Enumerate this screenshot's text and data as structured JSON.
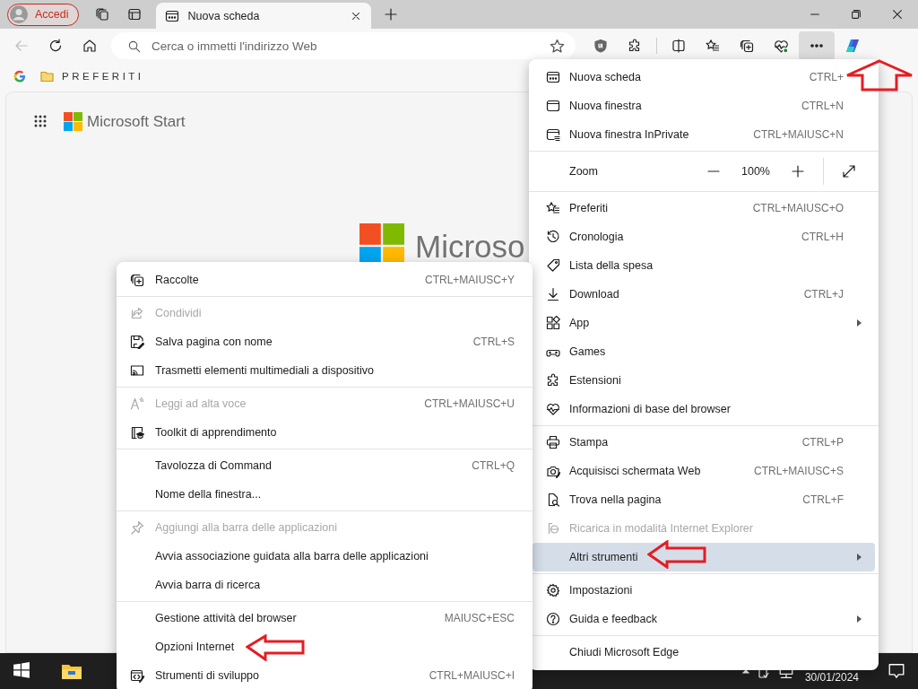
{
  "tab_strip": {
    "profile_button": "Accedi",
    "tabs": [
      {
        "label": "Nuova scheda",
        "selected": true
      }
    ]
  },
  "toolbar": {
    "address_placeholder": "Cerca o immetti l'indirizzo Web",
    "menu_button_pressed": true
  },
  "favorites_bar": {
    "items": [
      {
        "label": "PREFERITI"
      }
    ]
  },
  "page": {
    "brand": "Microsoft Start",
    "logo_text": "Microso"
  },
  "menu": {
    "groups": [
      {
        "items": [
          {
            "kind": "command",
            "label": "Nuova scheda",
            "shortcut": "CTRL+",
            "disabled": false,
            "selected": false,
            "submenu": false
          },
          {
            "kind": "command",
            "label": "Nuova finestra",
            "shortcut": "CTRL+N",
            "disabled": false,
            "selected": false,
            "submenu": false
          },
          {
            "kind": "command",
            "label": "Nuova finestra InPrivate",
            "shortcut": "CTRL+MAIUSC+N",
            "disabled": false,
            "selected": false,
            "submenu": false
          }
        ]
      },
      {
        "items": [
          {
            "kind": "zoom",
            "label": "Zoom",
            "value": "100%"
          }
        ]
      },
      {
        "items": [
          {
            "kind": "command",
            "label": "Preferiti",
            "shortcut": "CTRL+MAIUSC+O",
            "disabled": false,
            "selected": false,
            "submenu": false
          },
          {
            "kind": "command",
            "label": "Cronologia",
            "shortcut": "CTRL+H",
            "disabled": false,
            "selected": false,
            "submenu": false
          },
          {
            "kind": "command",
            "label": "Lista della spesa",
            "disabled": false,
            "selected": false,
            "submenu": false
          },
          {
            "kind": "command",
            "label": "Download",
            "shortcut": "CTRL+J",
            "disabled": false,
            "selected": false,
            "submenu": false
          },
          {
            "kind": "command",
            "label": "App",
            "disabled": false,
            "selected": false,
            "submenu": true
          },
          {
            "kind": "command",
            "label": "Games",
            "disabled": false,
            "selected": false,
            "submenu": false
          },
          {
            "kind": "command",
            "label": "Estensioni",
            "disabled": false,
            "selected": false,
            "submenu": false
          },
          {
            "kind": "command",
            "label": "Informazioni di base del browser",
            "disabled": false,
            "selected": false,
            "submenu": false
          }
        ]
      },
      {
        "items": [
          {
            "kind": "command",
            "label": "Stampa",
            "shortcut": "CTRL+P",
            "disabled": false,
            "selected": false,
            "submenu": false
          },
          {
            "kind": "command",
            "label": "Acquisisci schermata Web",
            "shortcut": "CTRL+MAIUSC+S",
            "disabled": false,
            "selected": false,
            "submenu": false
          },
          {
            "kind": "command",
            "label": "Trova nella pagina",
            "shortcut": "CTRL+F",
            "disabled": false,
            "selected": false,
            "submenu": false
          },
          {
            "kind": "command",
            "label": "Ricarica in modalità Internet Explorer",
            "disabled": true,
            "selected": false,
            "submenu": false
          },
          {
            "kind": "command",
            "label": "Altri strumenti",
            "disabled": false,
            "selected": true,
            "submenu": true
          }
        ]
      },
      {
        "items": [
          {
            "kind": "command",
            "label": "Impostazioni",
            "disabled": false,
            "selected": false,
            "submenu": false
          },
          {
            "kind": "command",
            "label": "Guida e feedback",
            "disabled": false,
            "selected": false,
            "submenu": true
          }
        ]
      },
      {
        "items": [
          {
            "kind": "command",
            "label": "Chiudi Microsoft Edge",
            "disabled": false,
            "selected": false,
            "submenu": false
          }
        ]
      }
    ]
  },
  "submenu": {
    "groups": [
      {
        "items": [
          {
            "label": "Raccolte",
            "shortcut": "CTRL+MAIUSC+Y",
            "disabled": false
          }
        ]
      },
      {
        "items": [
          {
            "label": "Condividi",
            "disabled": true
          },
          {
            "label": "Salva pagina con nome",
            "shortcut": "CTRL+S",
            "disabled": false
          },
          {
            "label": "Trasmetti elementi multimediali a dispositivo",
            "disabled": false
          }
        ]
      },
      {
        "items": [
          {
            "label": "Leggi ad alta voce",
            "shortcut": "CTRL+MAIUSC+U",
            "disabled": true
          },
          {
            "label": "Toolkit di apprendimento",
            "disabled": false
          }
        ]
      },
      {
        "items": [
          {
            "label": "Tavolozza di Command",
            "shortcut": "CTRL+Q",
            "disabled": false
          },
          {
            "label": "Nome della finestra...",
            "disabled": false
          }
        ]
      },
      {
        "items": [
          {
            "label": "Aggiungi alla barra delle applicazioni",
            "disabled": true
          },
          {
            "label": "Avvia associazione guidata alla barra delle applicazioni",
            "disabled": false
          },
          {
            "label": "Avvia barra di ricerca",
            "disabled": false
          }
        ]
      },
      {
        "items": [
          {
            "label": "Gestione attività del browser",
            "shortcut": "MAIUSC+ESC",
            "disabled": false
          },
          {
            "label": "Opzioni Internet",
            "disabled": false
          },
          {
            "label": "Strumenti di sviluppo",
            "shortcut": "CTRL+MAIUSC+I",
            "disabled": false
          }
        ]
      }
    ]
  },
  "taskbar": {
    "date": "30/01/2024"
  }
}
